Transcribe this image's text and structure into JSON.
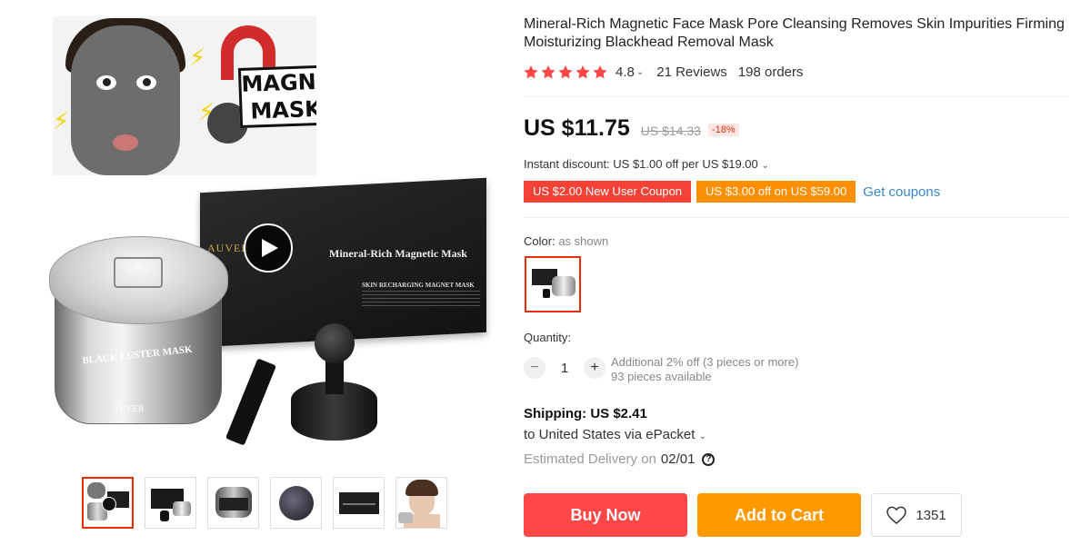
{
  "product": {
    "title": "Mineral-Rich Magnetic Face Mask Pore Cleansing Removes Skin Impurities Firming Moisturizing Blackhead Removal Mask"
  },
  "rating": {
    "stars": 5,
    "value": "4.8",
    "reviews": "21 Reviews",
    "orders": "198 orders"
  },
  "price": {
    "current": "US $11.75",
    "original": "US $14.33",
    "discount": "-18%"
  },
  "instant_discount": "Instant discount: US $1.00 off per US $19.00",
  "coupons": [
    "US $2.00 New User Coupon",
    "US $3.00 off on US $59.00"
  ],
  "get_coupons": "Get coupons",
  "color": {
    "label": "Color:",
    "value": "as shown"
  },
  "quantity": {
    "label": "Quantity:",
    "value": "1",
    "note": "Additional 2% off (3 pieces or more)",
    "available": "93 pieces available"
  },
  "shipping": {
    "title": "Shipping: US $2.41",
    "to": "to United States via ePacket",
    "estimated_label": "Estimated Delivery on",
    "estimated_date": "02/01"
  },
  "actions": {
    "buy_now": "Buy Now",
    "add_to_cart": "Add to Cart",
    "wishlist_count": "1351"
  },
  "gallery": {
    "promo_text": "MAGNETIC MASK?",
    "box_title": "Mineral-Rich Magnetic Mask",
    "box_brand": "AUVER",
    "box_subtitle": "SKIN RECHARGING MAGNET MASK",
    "jar_label": "BLACK LUSTER MASK",
    "jar_brand": "AUVER",
    "thumbnails": 6,
    "active_thumbnail": 1
  },
  "colors": {
    "price_red": "#e62e04",
    "star": "#ff4747",
    "buy": "#ff4747",
    "cart": "#ff9900",
    "link": "#3f88c5"
  }
}
